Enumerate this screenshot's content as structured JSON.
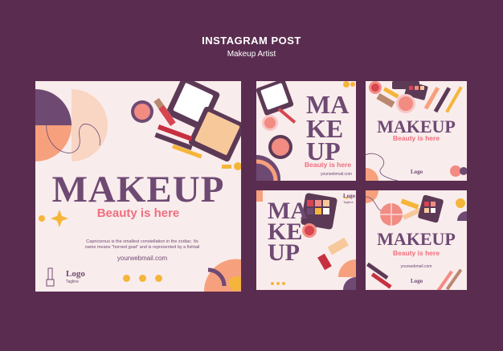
{
  "header": {
    "title": "INSTAGRAM POST",
    "subtitle": "Makeup Artist"
  },
  "main_post": {
    "headline": "MAKEUP",
    "tagline": "Beauty is here",
    "body": "Capricornus is the smallest constellation in the zodiac. Its name means \"horned goat\" and is represented by a fishtail",
    "email": "yourwebmail.com",
    "logo_text": "Logo",
    "logo_sub": "Tagline"
  },
  "post_1": {
    "line1": "MA",
    "line2": "KE",
    "line3": "UP",
    "tagline": "Beauty is here",
    "email": "yourwebmail.com"
  },
  "post_2": {
    "headline": "MAKEUP",
    "tagline": "Beauty is here",
    "logo_text": "Logo"
  },
  "post_3": {
    "line1": "MA",
    "line2": "KE",
    "line3": "UP",
    "logo_text": "Logo",
    "logo_sub": "Tagline"
  },
  "post_4": {
    "headline": "MAKEUP",
    "tagline": "Beauty is here",
    "email": "yourwebmail.com",
    "logo_text": "Logo"
  },
  "colors": {
    "background": "#5a2d50",
    "card": "#f9ecec",
    "title": "#6e4a73",
    "accent_pink": "#ee6f7e",
    "accent_orange": "#f5b53a"
  },
  "icons": [
    "compact-icon",
    "lipstick-icon",
    "eyeshadow-palette-icon",
    "brush-icon",
    "powder-icon",
    "social-icon",
    "lipstick-logo-icon"
  ]
}
